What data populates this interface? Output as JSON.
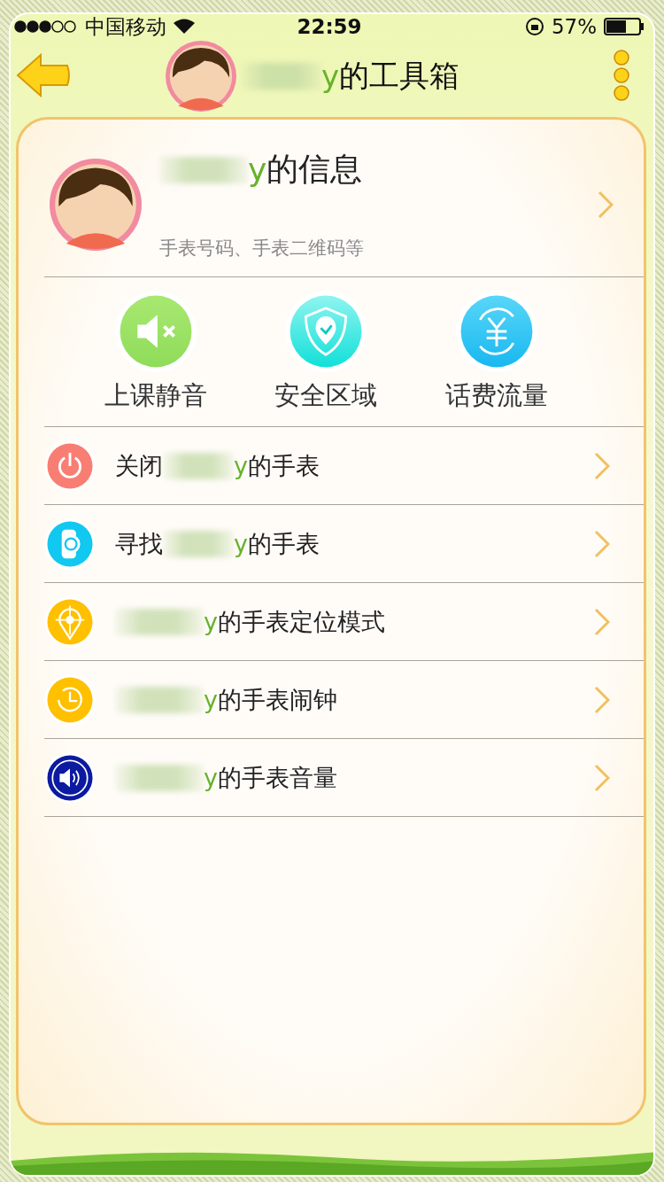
{
  "status_bar": {
    "carrier": "中国移动",
    "time": "22:59",
    "battery": "57%"
  },
  "header": {
    "name": "y",
    "title_suffix": "的工具箱"
  },
  "profile": {
    "name": "y",
    "title_suffix": "的信息",
    "subtitle": "手表号码、手表二维码等"
  },
  "quick_actions": [
    {
      "kind": "mute",
      "label": "上课静音"
    },
    {
      "kind": "shield",
      "label": "安全区域"
    },
    {
      "kind": "money",
      "label": "话费流量"
    }
  ],
  "menu": [
    {
      "kind": "power",
      "prefix": "关闭",
      "name": "y",
      "suffix": "的手表"
    },
    {
      "kind": "watch",
      "prefix": "寻找",
      "name": "y",
      "suffix": "的手表"
    },
    {
      "kind": "location",
      "name": "y",
      "suffix": "的手表定位模式"
    },
    {
      "kind": "clock",
      "name": "y",
      "suffix": "的手表闹钟"
    },
    {
      "kind": "volume",
      "name": "y",
      "suffix": "的手表音量"
    }
  ]
}
